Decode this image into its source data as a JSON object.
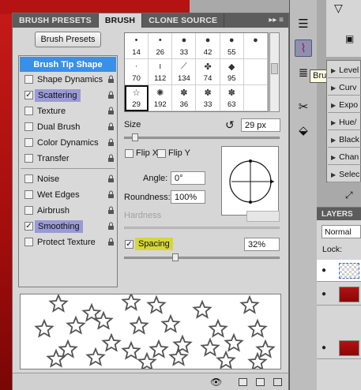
{
  "tabs": [
    {
      "label": "BRUSH PRESETS",
      "active": false
    },
    {
      "label": "BRUSH",
      "active": true
    },
    {
      "label": "CLONE SOURCE",
      "active": false
    }
  ],
  "tab_menu_glyph": "▸▸ ≡",
  "brush_presets_button": "Brush Presets",
  "brush_tip_shape": "Brush Tip Shape",
  "options": [
    {
      "label": "Shape Dynamics",
      "checked": false,
      "highlight": false
    },
    {
      "label": "Scattering",
      "checked": true,
      "highlight": true
    },
    {
      "label": "Texture",
      "checked": false,
      "highlight": false
    },
    {
      "label": "Dual Brush",
      "checked": false,
      "highlight": false
    },
    {
      "label": "Color Dynamics",
      "checked": false,
      "highlight": false
    },
    {
      "label": "Transfer",
      "checked": false,
      "highlight": false
    },
    {
      "label": "Noise",
      "checked": false,
      "highlight": false
    },
    {
      "label": "Wet Edges",
      "checked": false,
      "highlight": false
    },
    {
      "label": "Airbrush",
      "checked": false,
      "highlight": false
    },
    {
      "label": "Smoothing",
      "checked": true,
      "highlight": true
    },
    {
      "label": "Protect Texture",
      "checked": false,
      "highlight": false
    }
  ],
  "brush_grid": [
    [
      "14",
      "26",
      "33",
      "42",
      "55",
      ""
    ],
    [
      "70",
      "112",
      "134",
      "74",
      "95",
      ""
    ],
    [
      "29",
      "192",
      "36",
      "33",
      "63",
      ""
    ]
  ],
  "size_label": "Size",
  "size_value": "29 px",
  "size_fraction": 0.05,
  "flip_x_label": "Flip X",
  "flip_y_label": "Flip Y",
  "angle_label": "Angle:",
  "angle_value": "0°",
  "roundness_label": "Roundness:",
  "roundness_value": "100%",
  "hardness_label": "Hardness",
  "spacing_label": "Spacing",
  "spacing_value": "32%",
  "spacing_fraction": 0.32,
  "dock_tooltip": "Brush",
  "adjust_items": [
    "Level",
    "Curv",
    "Expo",
    "Hue/",
    "Black",
    "Chan",
    "Selec"
  ],
  "layers_title": "LAYERS",
  "blend_mode": "Normal",
  "lock_label": "Lock:",
  "colors": {
    "header_blue": "#3a8fe6",
    "option_highlight": "#9a9ad6",
    "spacing_highlight": "#d7d63a",
    "canvas_red": "#b51313"
  }
}
